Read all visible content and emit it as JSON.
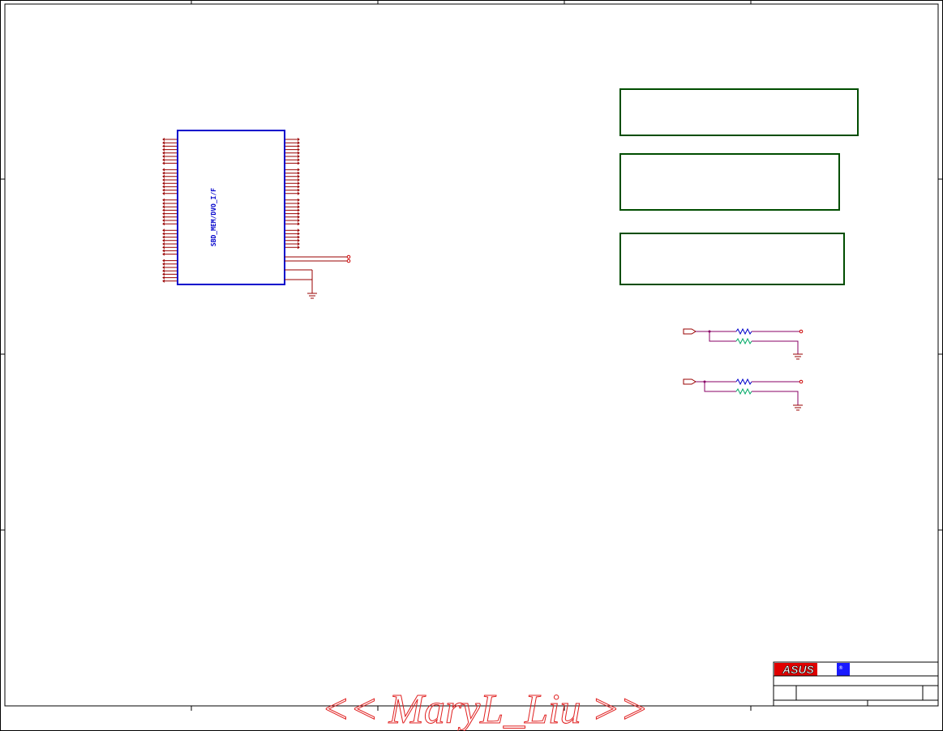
{
  "schematic": {
    "chip_label": "SBD_MEM/DVO_I/F",
    "brand": "ASUS",
    "brand_mark": "®",
    "watermark": "<< MaryL_Liu >>"
  },
  "colors": {
    "frame": "#000000",
    "chip_outline": "#0000cc",
    "wire": "#990000",
    "box_outline": "#004d00",
    "resistor": "#0000cc",
    "resistor_alt": "#00aa66",
    "wire_violet": "#880066",
    "watermark": "#e02020",
    "brand_red": "#e00000",
    "brand_blue": "#1a1aff"
  }
}
